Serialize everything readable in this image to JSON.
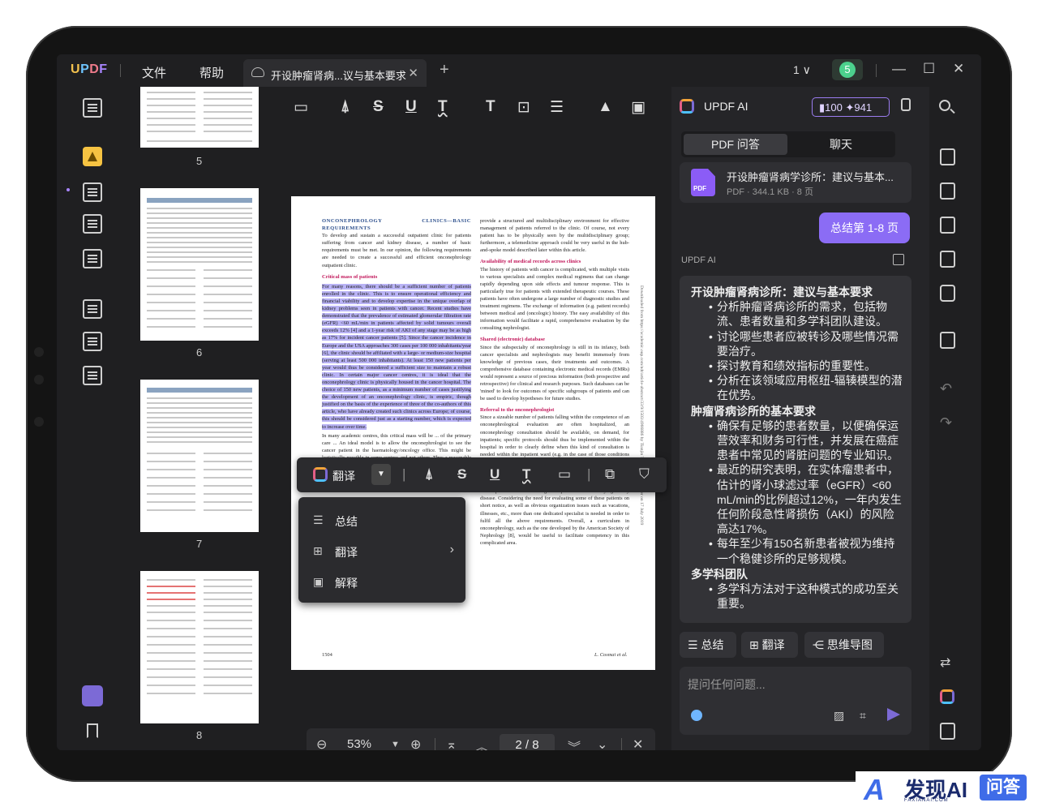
{
  "app": {
    "logo": "UPDF",
    "menu": [
      "文件",
      "帮助"
    ],
    "tab_title": "开设肿瘤肾病...议与基本要求",
    "tab_close": "✕",
    "add_tab": "+",
    "page_selector": "1 ∨",
    "user_initial": "5"
  },
  "thumbnails": [
    {
      "page": "5"
    },
    {
      "page": "6"
    },
    {
      "page": "7"
    },
    {
      "page": "8"
    }
  ],
  "document": {
    "section_title": "ONCONEPHROLOGY CLINICS—BASIC REQUIREMENTS",
    "intro": "To develop and sustain a successful outpatient clinic for patients suffering from cancer and kidney disease, a number of basic requirements must be met. In our opinion, the following requirements are needed to create a successful and efficient onconephrology outpatient clinic.",
    "critical_title": "Critical mass of patients",
    "critical_text": "For many reasons, there should be a sufficient number of patients enrolled in the clinic. This is to ensure operational efficiency and financial viability and to develop expertise in the unique overlap of kidney problems seen in patients with cancer. Recent studies have demonstrated that the prevalence of estimated glomerular filtration rate (eGFR) <60 mL/min in patients affected by solid tumours overall exceeds 12% [4] and a 1-year risk of AKI of any stage may be as high as 17% for incident cancer patients [5]. Since the cancer incidence in Europe and the USA approaches 300 cases per 100 000 inhabitants/year [6], the clinic should be affiliated with a large- or medium-size hospital (serving at least 500 000 inhabitants). At least 150 new patients per year would thus be considered a sufficient size to maintain a robust clinic. In certain major cancer centres, it is ideal that the onconephrology clinic is physically housed in the cancer hospital. The choice of 150 new patients, as a minimum number of cases justifying the development of an onconephrology clinic, is empiric, though justified on the basis of the experience of three of the co-authors of this article, who have already created such clinics across Europe; of course, this should be considered just as a starting number, which is expected to increase over time.",
    "left_after": "In many academic centres, this critical mass will be ... of the primary care ... An ideal model is to allow the onconephrologist to see the cancer patient in the haematology/oncology office. This might be logistically possible in some centres and not others. Thus a reasonable physical proximity would be a key requirement to",
    "right_top": "provide a structured and multidisciplinary environment for effective management of patients referred to the clinic. Of course, not every patient has to be physically seen by the multidisciplinary group; furthermore, a telemedicine approach could be very useful in the hub-and-spoke model described later within this article.",
    "records_title": "Availability of medical records across clinics",
    "records_text": "The history of patients with cancer is complicated, with multiple visits to various specialists and complex medical regimens that can change rapidly depending upon side effects and tumour response. This is particularly true for patients with extended therapeutic courses. These patients have often undergone a large number of diagnostic studies and treatment regimens. The exchange of information (e.g. patient records) between medical and (oncologic) history. The easy availability of this information would facilitate a rapid, comprehensive evaluation by the consulting nephrologist.",
    "db_title": "Shared (electronic) database",
    "db_text": "Since the subspecialty of onconephrology is still in its infancy, both cancer specialists and nephrologists may benefit immensely from knowledge of previous cases, their treatments and outcomes. A comprehensive database containing electronic medical records (EMRs) would represent a source of precious information (both prospective and retrospective) for clinical and research purposes. Such databases can be 'mined' to look for outcomes of specific subgroups of patients and can be used to develop hypotheses for future studies.",
    "referral_title": "Referral to the onconephrologist",
    "referral_text": "Since a sizeable number of patients falling within the competence of an onconephrological evaluation are often hospitalized, an onconephrology consultation should be available, on demand, for inpatients; specific protocols should thus be implemented within the hospital in order to clearly define when this kind of consultation is needed within the inpatient ward (e.g. in the case of those conditions reported in Table 1) and how to ask for it. The onconephrology consultant must be versed and knowledgeable in the complex relationships between cancer and the kidney, the pharmacological properties of all antineoplastic drugs and the harm:benefit ratio of antineoplastic treatment strategies in patients with underlying kidney disease. Considering the need for evaluating some of these patients on short notice, as well as obvious organization issues such as vacations, illnesses, etc., more than one dedicated specialist is needed in order to fulfil all the above requirements. Overall, a curriculum in onconephrology, such as the one developed by the American Society of Nephrology [8], would be useful to facilitate competency in this complicated area.",
    "side_note": "Downloaded from https://academic.oup.com/ndt/article-abstract/33/9/1503/4966886 by Tianjin Teach University user on 17 July 2019",
    "page_num": "1504",
    "footer_author": "L. Cosmai et al."
  },
  "float_toolbar": {
    "translate_label": "翻译"
  },
  "context_menu": {
    "items": [
      {
        "icon": "list-icon",
        "label": "总结"
      },
      {
        "icon": "translate-icon",
        "label": "翻译"
      },
      {
        "icon": "explain-icon",
        "label": "解释"
      }
    ]
  },
  "bottom_nav": {
    "zoom": "53%",
    "page": "2 / 8"
  },
  "ai_panel": {
    "title": "UPDF AI",
    "credits_a": "100",
    "credits_b": "941",
    "tab_pdf": "PDF 问答",
    "tab_chat": "聊天",
    "file_name": "开设肿瘤肾病学诊所：建议与基本...",
    "file_meta": "PDF · 344.1 KB · 8 页",
    "pdf_badge": "PDF",
    "user_message": "总结第 1-8 页",
    "ai_label": "UPDF AI",
    "answer": {
      "h1": "开设肿瘤肾病诊所：建议与基本要求",
      "list1": [
        "分析肿瘤肾病诊所的需求，包括物流、患者数量和多学科团队建设。",
        "讨论哪些患者应被转诊及哪些情况需要治疗。",
        "探讨教育和绩效指标的重要性。",
        "分析在该领域应用枢纽-辐辏模型的潜在优势。"
      ],
      "h2": "肿瘤肾病诊所的基本要求",
      "list2": [
        "确保有足够的患者数量，以便确保运营效率和财务可行性，并发展在癌症患者中常见的肾脏问题的专业知识。",
        "最近的研究表明，在实体瘤患者中，估计的肾小球滤过率（eGFR）<60 mL/min的比例超过12%，一年内发生任何阶段急性肾损伤（AKI）的风险高达17%。",
        "每年至少有150名新患者被视为维持一个稳健诊所的足够规模。"
      ],
      "h3": "多学科团队",
      "list3": [
        "多学科方法对于这种模式的成功至关重要。"
      ]
    },
    "chips": [
      "总结",
      "翻译",
      "思维导图"
    ],
    "input_placeholder": "提问任何问题..."
  },
  "watermark": {
    "brand": "发现AI",
    "sub": "FAXIANAI.COM",
    "qa": "问答"
  }
}
